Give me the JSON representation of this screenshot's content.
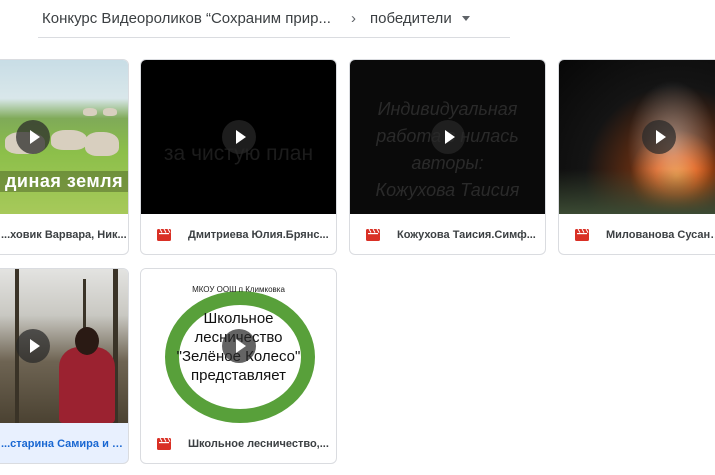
{
  "breadcrumb": {
    "parent": "Конкурс Видеороликов “Сохраним прир...",
    "separator": "›",
    "current": "победители"
  },
  "colors": {
    "video_icon": "#d93025",
    "selected_bg": "#e8f0fe",
    "selected_text": "#1967d2",
    "border": "#dadce0"
  },
  "files": [
    {
      "name": "...ховик Варвара, Ник...",
      "thumb_text": "диная земля",
      "icon": "video-file-icon",
      "selected": false
    },
    {
      "name": "Дмитриева Юлия.Брянс...",
      "thumb_text": "за  чистую  план",
      "icon": "video-file-icon",
      "selected": false
    },
    {
      "name": "Кожухова Таисия.Симф...",
      "thumb_text": "Индивидуальная\nработа с  нилась\nавторы:\nКожухова Таисия",
      "icon": "video-file-icon",
      "selected": false
    },
    {
      "name": "Милованова Сусанна...",
      "thumb_text": "",
      "icon": "video-file-icon",
      "selected": false
    },
    {
      "name": "...старина Самира и Ди...",
      "thumb_text": "",
      "icon": "video-file-icon",
      "selected": true
    },
    {
      "name": "Школьное лесничество,...",
      "thumb_top": "МКОУ ООШ п Климковка",
      "thumb_text": "Школьное\nлесничество\n\"Зелёное Колесо\"\nпредставляет",
      "icon": "video-file-icon",
      "selected": false
    }
  ]
}
